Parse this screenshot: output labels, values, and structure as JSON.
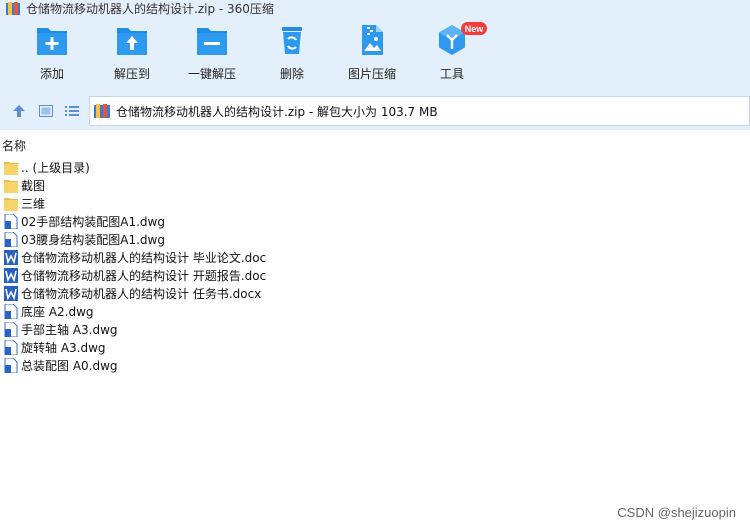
{
  "window": {
    "title": "仓储物流移动机器人的结构设计.zip - 360压缩",
    "app_icon": "archive-icon"
  },
  "toolbar": {
    "items": [
      {
        "label": "添加",
        "icon": "add-folder-icon"
      },
      {
        "label": "解压到",
        "icon": "extract-to-icon"
      },
      {
        "label": "一键解压",
        "icon": "one-click-extract-icon"
      },
      {
        "label": "删除",
        "icon": "recycle-bin-icon"
      },
      {
        "label": "图片压缩",
        "icon": "image-compress-icon"
      },
      {
        "label": "工具",
        "icon": "tools-cube-icon",
        "badge": "New"
      }
    ]
  },
  "navbar": {
    "address": "仓储物流移动机器人的结构设计.zip - 解包大小为 103.7 MB"
  },
  "list": {
    "column_header": "名称",
    "files": [
      {
        "name": ".. (上级目录)",
        "type": "folder"
      },
      {
        "name": "截图",
        "type": "folder"
      },
      {
        "name": "三维",
        "type": "folder"
      },
      {
        "name": "02手部结构装配图A1.dwg",
        "type": "dwg"
      },
      {
        "name": "03腰身结构装配图A1.dwg",
        "type": "dwg"
      },
      {
        "name": "仓储物流移动机器人的结构设计 毕业论文.doc",
        "type": "word"
      },
      {
        "name": "仓储物流移动机器人的结构设计 开题报告.doc",
        "type": "word"
      },
      {
        "name": "仓储物流移动机器人的结构设计 任务书.docx",
        "type": "word"
      },
      {
        "name": "底座 A2.dwg",
        "type": "dwg"
      },
      {
        "name": "手部主轴 A3.dwg",
        "type": "dwg"
      },
      {
        "name": "旋转轴 A3.dwg",
        "type": "dwg"
      },
      {
        "name": "总装配图 A0.dwg",
        "type": "dwg"
      }
    ]
  },
  "watermark": "CSDN @shejizuopin",
  "colors": {
    "toolbar_bg": "#e3f0fc",
    "accent_blue": "#1f8ce8",
    "folder_yellow": "#f7d36b",
    "word_blue": "#2b5fbd",
    "badge_red": "#f23c3c"
  }
}
